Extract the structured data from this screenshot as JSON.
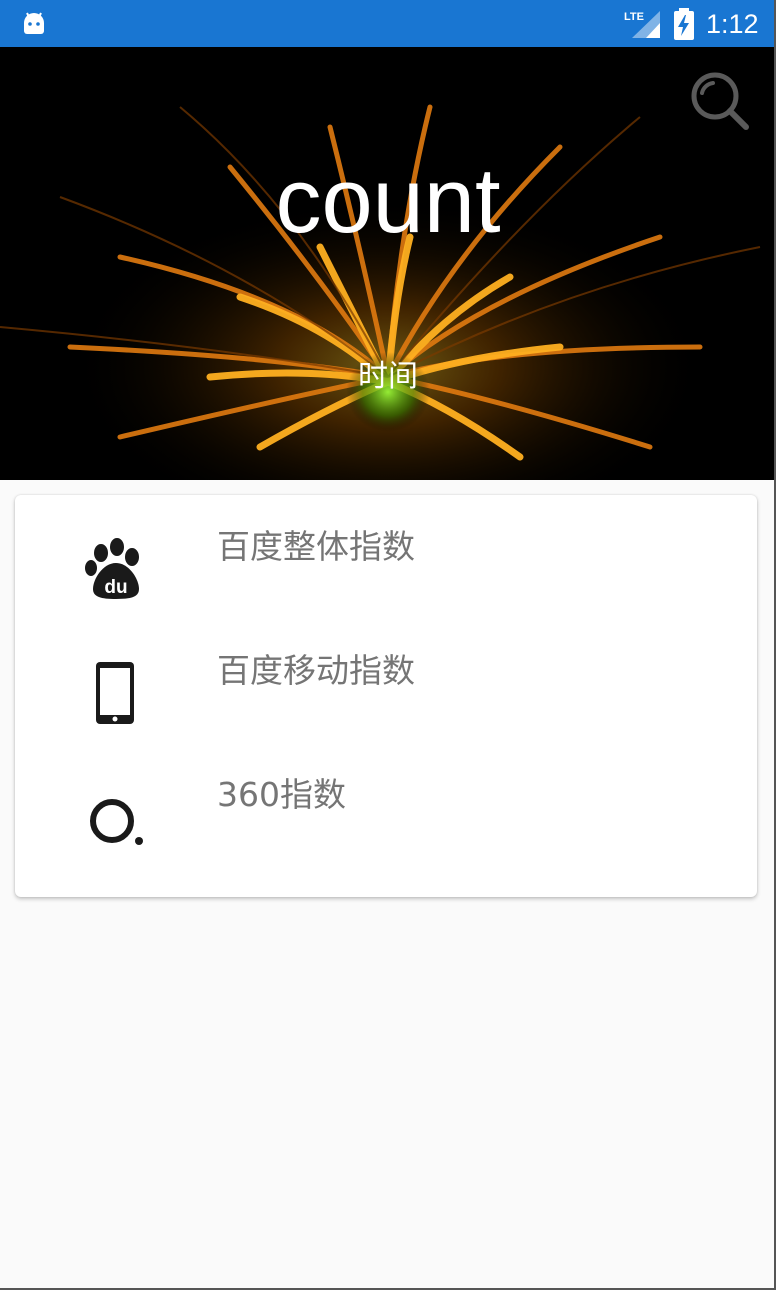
{
  "status_bar": {
    "network": "LTE",
    "time": "1:12",
    "icons": [
      "android-icon",
      "lte-signal-icon",
      "battery-charging-icon"
    ]
  },
  "header": {
    "title": "count",
    "subtitle": "时间",
    "search_icon": "search-icon"
  },
  "list": {
    "items": [
      {
        "label": "百度整体指数",
        "icon": "baidu-paw-icon"
      },
      {
        "label": "百度移动指数",
        "icon": "smartphone-icon"
      },
      {
        "label": "360指数",
        "icon": "360-logo-icon"
      }
    ]
  },
  "colors": {
    "status_bar": "#1976d2",
    "hero_background": "#000000",
    "label_text": "#757575",
    "page_background": "#fafafa",
    "card_background": "#ffffff"
  }
}
